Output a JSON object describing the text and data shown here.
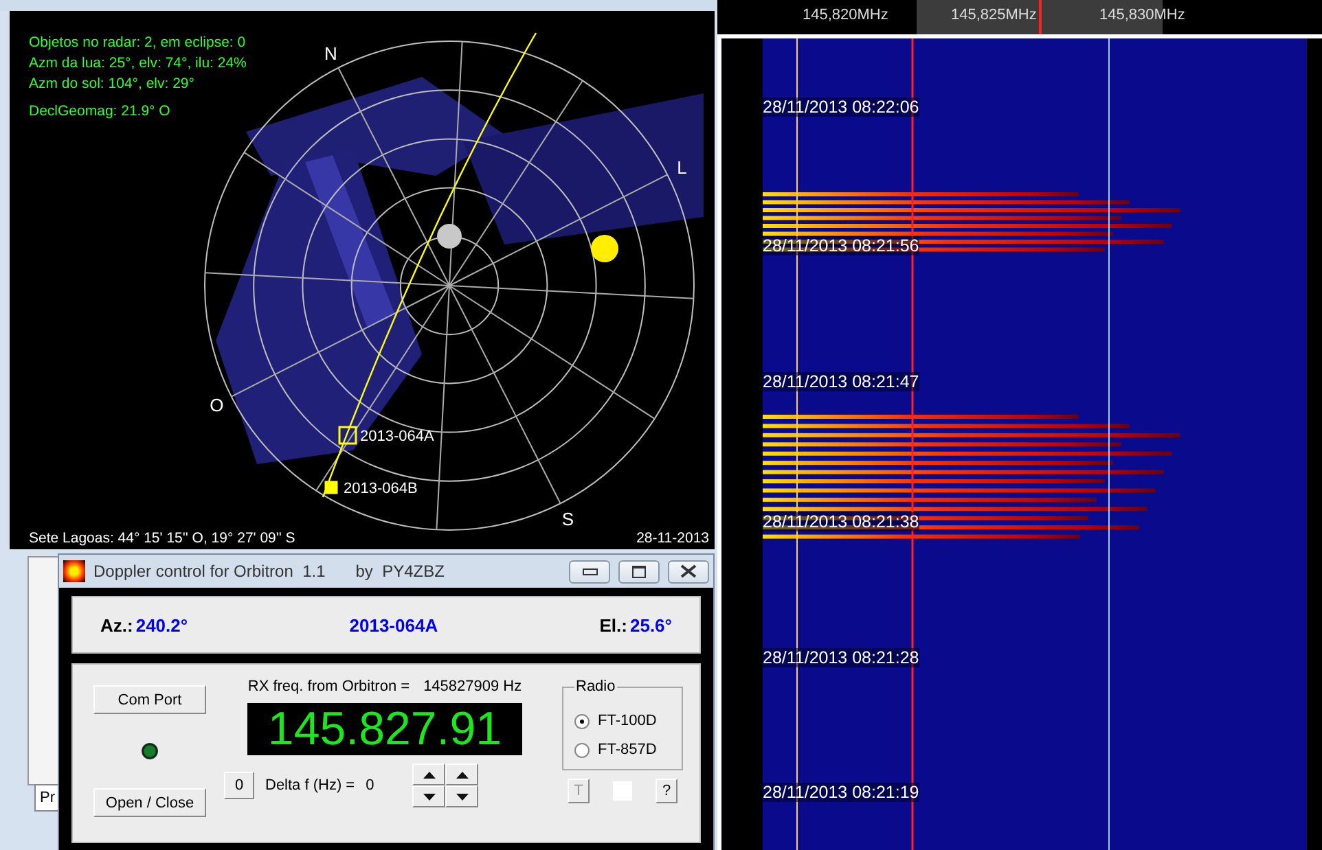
{
  "orbitron": {
    "info_lines": [
      "Objetos no radar: 2, em eclipse: 0",
      "Azm da lua: 25°, elv: 74°, ilu: 24%",
      "Azm do sol: 104°, elv: 29°",
      "DeclGeomag: 21.9° O"
    ],
    "compass": [
      "N",
      "L",
      "S",
      "O"
    ],
    "satellites": [
      {
        "label": "2013-064A",
        "selected": true
      },
      {
        "label": "2013-064B",
        "selected": false
      }
    ],
    "location": "Sete Lagoas: 44° 15' 15'' O, 19° 27' 09'' S",
    "date": "28-11-2013",
    "tab": "Pr"
  },
  "doppler": {
    "title": "Doppler control for Orbitron  1.1",
    "author": "by  PY4ZBZ",
    "az_label": "Az.:",
    "az": "240.2°",
    "satellite": "2013-064A",
    "el_label": "El.:",
    "el": "25.6°",
    "com_port": "Com Port",
    "open_close": "Open / Close",
    "rx_label": "RX freq. from Orbitron =",
    "rx_value": "145827909 Hz",
    "display": "145.827.91",
    "zero": "0",
    "delta_label": "Delta f (Hz) =",
    "delta": "0",
    "radio_title": "Radio",
    "radios": [
      {
        "label": "FT-100D",
        "selected": true
      },
      {
        "label": "FT-857D",
        "selected": false
      }
    ],
    "t_button": "T",
    "help_button": "?"
  },
  "waterfall": {
    "freqs": [
      "145,820MHz",
      "145,825MHz",
      "145,830MHz"
    ],
    "timestamps": [
      "28/11/2013 08:22:06",
      "28/11/2013 08:21:56",
      "28/11/2013 08:21:47",
      "28/11/2013 08:21:38",
      "28/11/2013 08:21:28",
      "28/11/2013 08:21:19"
    ]
  }
}
